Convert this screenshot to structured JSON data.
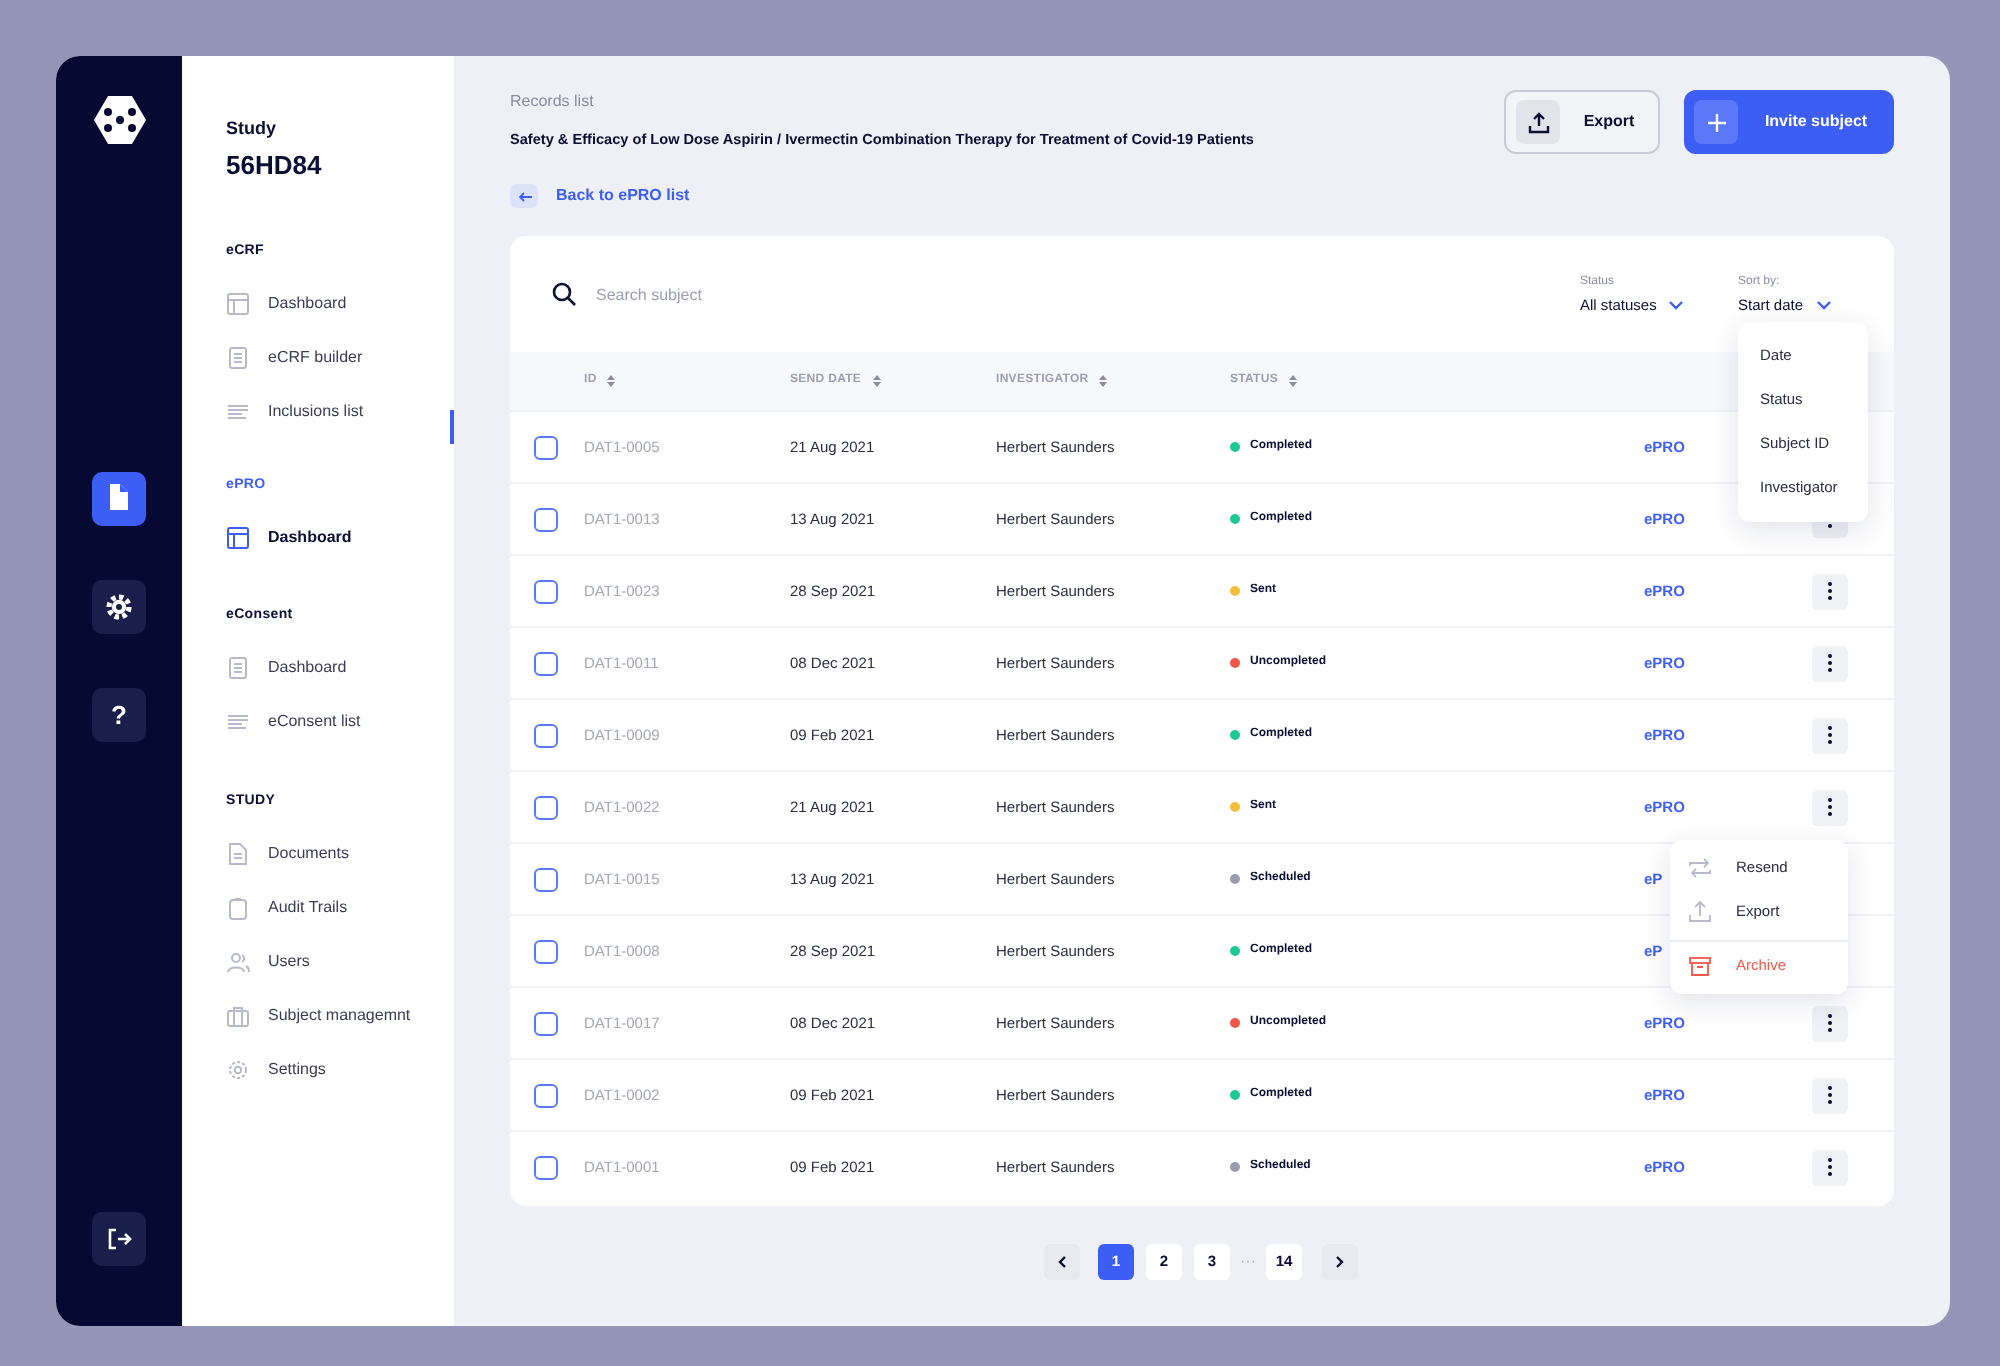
{
  "rail": {
    "items": [
      {
        "kind": "document",
        "selected": true
      },
      {
        "kind": "settings",
        "selected": false
      },
      {
        "kind": "help",
        "label": "?",
        "selected": false
      }
    ]
  },
  "sidebar": {
    "study_label": "Study",
    "study_code": "56HD84",
    "sections": [
      {
        "title": "eCRF",
        "items": [
          {
            "label": "Dashboard",
            "kind": "layout",
            "selected": false
          },
          {
            "label": "eCRF builder",
            "kind": "form",
            "selected": false
          },
          {
            "label": "Inclusions list",
            "kind": "lines",
            "selected": false
          }
        ]
      },
      {
        "title": "ePRO",
        "items": [
          {
            "label": "Dashboard",
            "kind": "layout",
            "selected": true
          }
        ]
      },
      {
        "title": "eConsent",
        "items": [
          {
            "label": "Dashboard",
            "kind": "form",
            "selected": false
          },
          {
            "label": "eConsent list",
            "kind": "lines",
            "selected": false
          }
        ]
      },
      {
        "title": "STUDY",
        "items": [
          {
            "label": "Documents",
            "kind": "document",
            "selected": false
          },
          {
            "label": "Audit Trails",
            "kind": "clipboard",
            "selected": false
          },
          {
            "label": "Users",
            "kind": "users",
            "selected": false
          },
          {
            "label": "Subject managemnt",
            "kind": "briefcase",
            "selected": false
          },
          {
            "label": "Settings",
            "kind": "gear",
            "selected": false
          }
        ]
      }
    ]
  },
  "header": {
    "breadcrumb": "Records list",
    "title": "Safety & Efficacy of Low Dose Aspirin / Ivermectin Combination Therapy for Treatment of Covid-19 Patients",
    "buttons": [
      {
        "label": "Export",
        "kind": "secondary"
      },
      {
        "label": "Invite subject",
        "kind": "primary"
      }
    ],
    "back_link": "Back to ePRO list"
  },
  "table": {
    "search": {
      "placeholder": "Search subject"
    },
    "filters": [
      {
        "label": "Status",
        "value": "All statuses"
      },
      {
        "label": "Sort by:",
        "value": "Start date"
      }
    ],
    "columns": [
      "ID",
      "SEND DATE",
      "INVESTIGATOR",
      "STATUS"
    ],
    "rows": [
      {
        "id": "DAT1-0005",
        "date": "21 Aug 2021",
        "investigator": "Herbert Saunders",
        "status": "Completed",
        "color": "#1ec997",
        "link": "ePRO",
        "menu_button": false,
        "checked": false
      },
      {
        "id": "DAT1-0013",
        "date": "13 Aug 2021",
        "investigator": "Herbert Saunders",
        "status": "Completed",
        "color": "#1ec997",
        "link": "ePRO",
        "menu_button": true,
        "checked": false
      },
      {
        "id": "DAT1-0023",
        "date": "28 Sep 2021",
        "investigator": "Herbert Saunders",
        "status": "Sent",
        "color": "#f8bd3c",
        "link": "ePRO",
        "menu_button": true,
        "checked": false
      },
      {
        "id": "DAT1-0011",
        "date": "08 Dec 2021",
        "investigator": "Herbert Saunders",
        "status": "Uncompleted",
        "color": "#f2574a",
        "link": "ePRO",
        "menu_button": true,
        "checked": false
      },
      {
        "id": "DAT1-0009",
        "date": "09 Feb 2021",
        "investigator": "Herbert Saunders",
        "status": "Completed",
        "color": "#1ec997",
        "link": "ePRO",
        "menu_button": true,
        "checked": false
      },
      {
        "id": "DAT1-0022",
        "date": "21 Aug 2021",
        "investigator": "Herbert Saunders",
        "status": "Sent",
        "color": "#f8bd3c",
        "link": "ePRO",
        "menu_button": true,
        "checked": false
      },
      {
        "id": "DAT1-0015",
        "date": "13 Aug 2021",
        "investigator": "Herbert Saunders",
        "status": "Scheduled",
        "color": "#9b9cae",
        "link": "eP",
        "menu_button": false,
        "checked": false
      },
      {
        "id": "DAT1-0008",
        "date": "28 Sep 2021",
        "investigator": "Herbert Saunders",
        "status": "Completed",
        "color": "#1ec997",
        "link": "eP",
        "menu_button": false,
        "checked": false
      },
      {
        "id": "DAT1-0017",
        "date": "08 Dec 2021",
        "investigator": "Herbert Saunders",
        "status": "Uncompleted",
        "color": "#f2574a",
        "link": "ePRO",
        "menu_button": true,
        "checked": false
      },
      {
        "id": "DAT1-0002",
        "date": "09 Feb 2021",
        "investigator": "Herbert Saunders",
        "status": "Completed",
        "color": "#1ec997",
        "link": "ePRO",
        "menu_button": true,
        "checked": false
      },
      {
        "id": "DAT1-0001",
        "date": "09 Feb 2021",
        "investigator": "Herbert Saunders",
        "status": "Scheduled",
        "color": "#9b9cae",
        "link": "ePRO",
        "menu_button": true,
        "checked": false
      }
    ]
  },
  "sort_menu": {
    "items": [
      "Date",
      "Status",
      "Subject ID",
      "Investigator"
    ]
  },
  "row_menu": {
    "items": [
      {
        "label": "Resend",
        "kind": "resend"
      },
      {
        "label": "Export",
        "kind": "export"
      },
      {
        "label": "Archive",
        "kind": "archive"
      }
    ]
  },
  "pagination": {
    "items": [
      {
        "kind": "prev"
      },
      {
        "kind": "page",
        "label": "1",
        "selected": true
      },
      {
        "kind": "page",
        "label": "2",
        "selected": false
      },
      {
        "kind": "page",
        "label": "3",
        "selected": false
      },
      {
        "kind": "ellipsis",
        "label": "···"
      },
      {
        "kind": "page",
        "label": "14",
        "selected": false
      },
      {
        "kind": "next"
      }
    ]
  }
}
